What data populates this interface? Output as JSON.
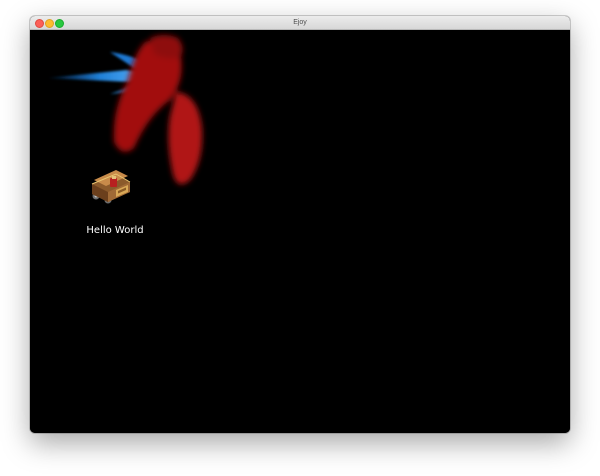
{
  "window": {
    "title": "Ejoy"
  },
  "canvas": {
    "icon_label": "Hello World",
    "icon_name": "treasure-cart-icon"
  },
  "colors": {
    "background": "#000000",
    "label_text": "#ffffff",
    "blue_streak": "#2a8fe0",
    "red_blob": "#a01414"
  }
}
